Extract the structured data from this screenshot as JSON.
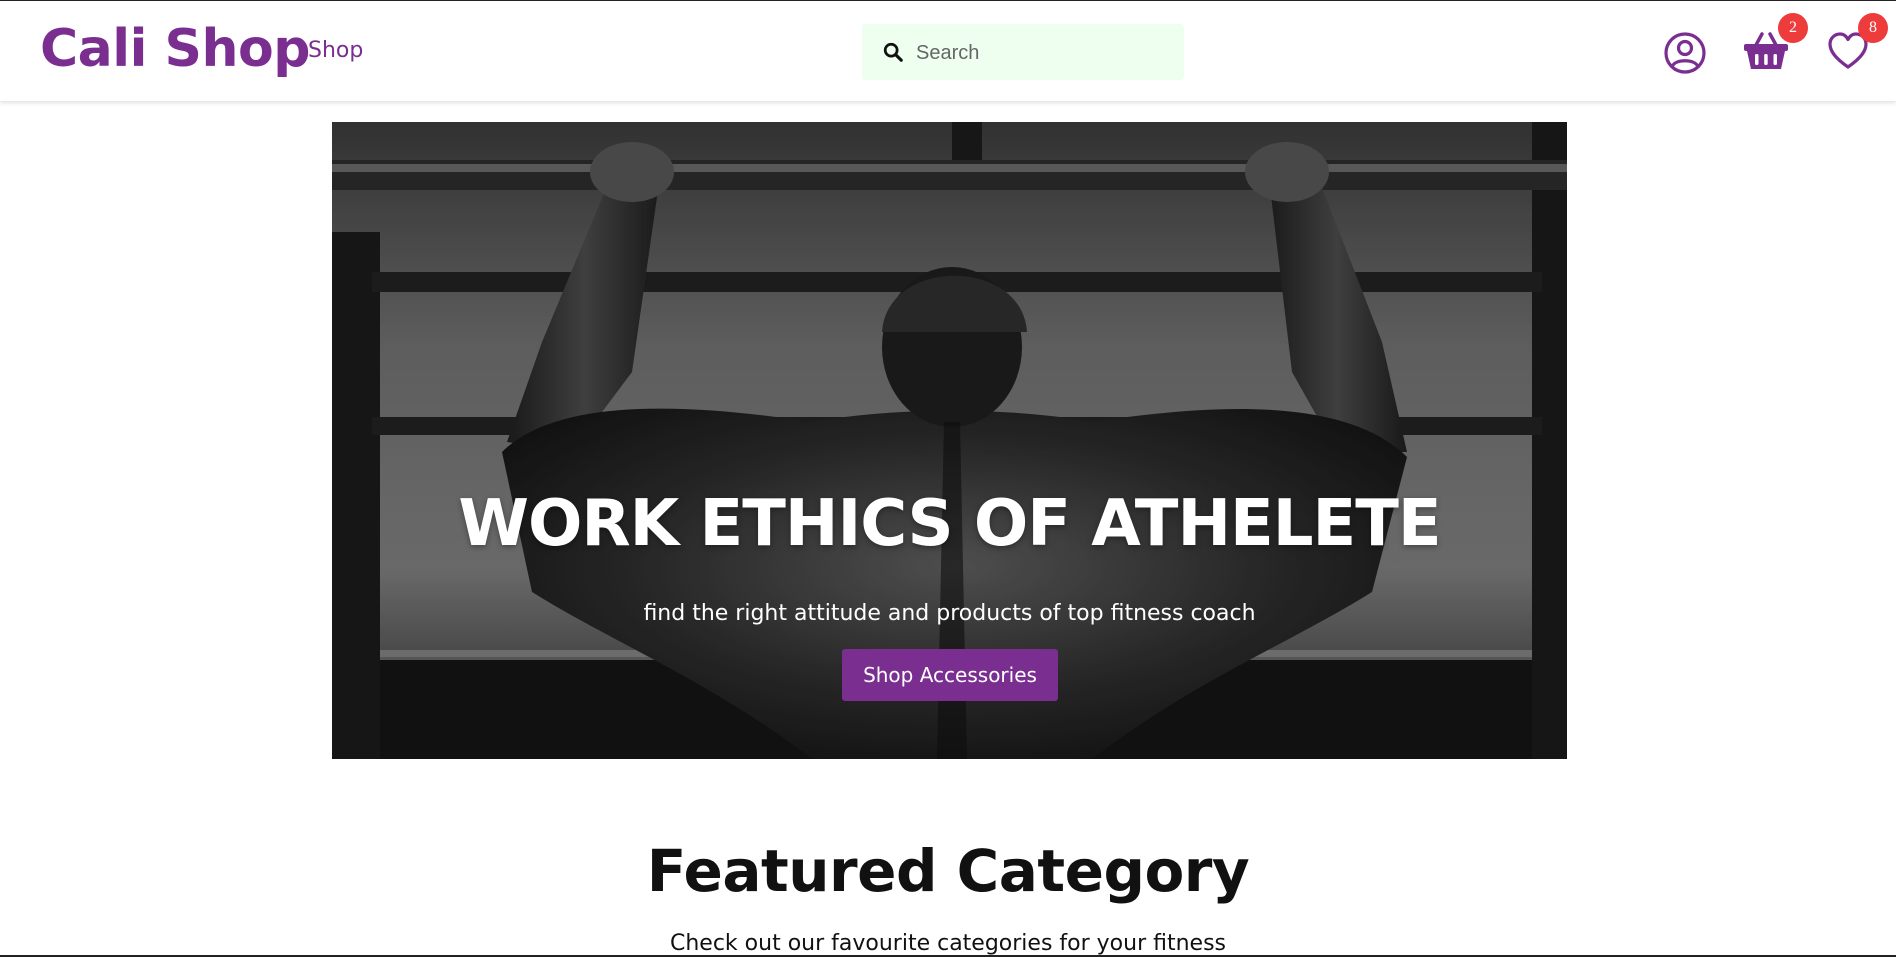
{
  "header": {
    "brand": "Cali Shop",
    "nav_shop": "Shop",
    "search_placeholder": "Search",
    "cart_count": "2",
    "wishlist_count": "8"
  },
  "hero": {
    "title": "WORK ETHICS OF ATHELETE",
    "subtitle": "find the right attitude and products of top fitness coach",
    "button_label": "Shop Accessories"
  },
  "featured": {
    "title": "Featured Category",
    "subtitle": "Check out our favourite categories for your fitness"
  },
  "colors": {
    "brand": "#7a2e90",
    "badge": "#ee3b3b",
    "search_bg": "#eefff0"
  },
  "icons": {
    "search": "search-icon",
    "account": "user-circle-icon",
    "cart": "basket-icon",
    "wishlist": "heart-icon"
  }
}
